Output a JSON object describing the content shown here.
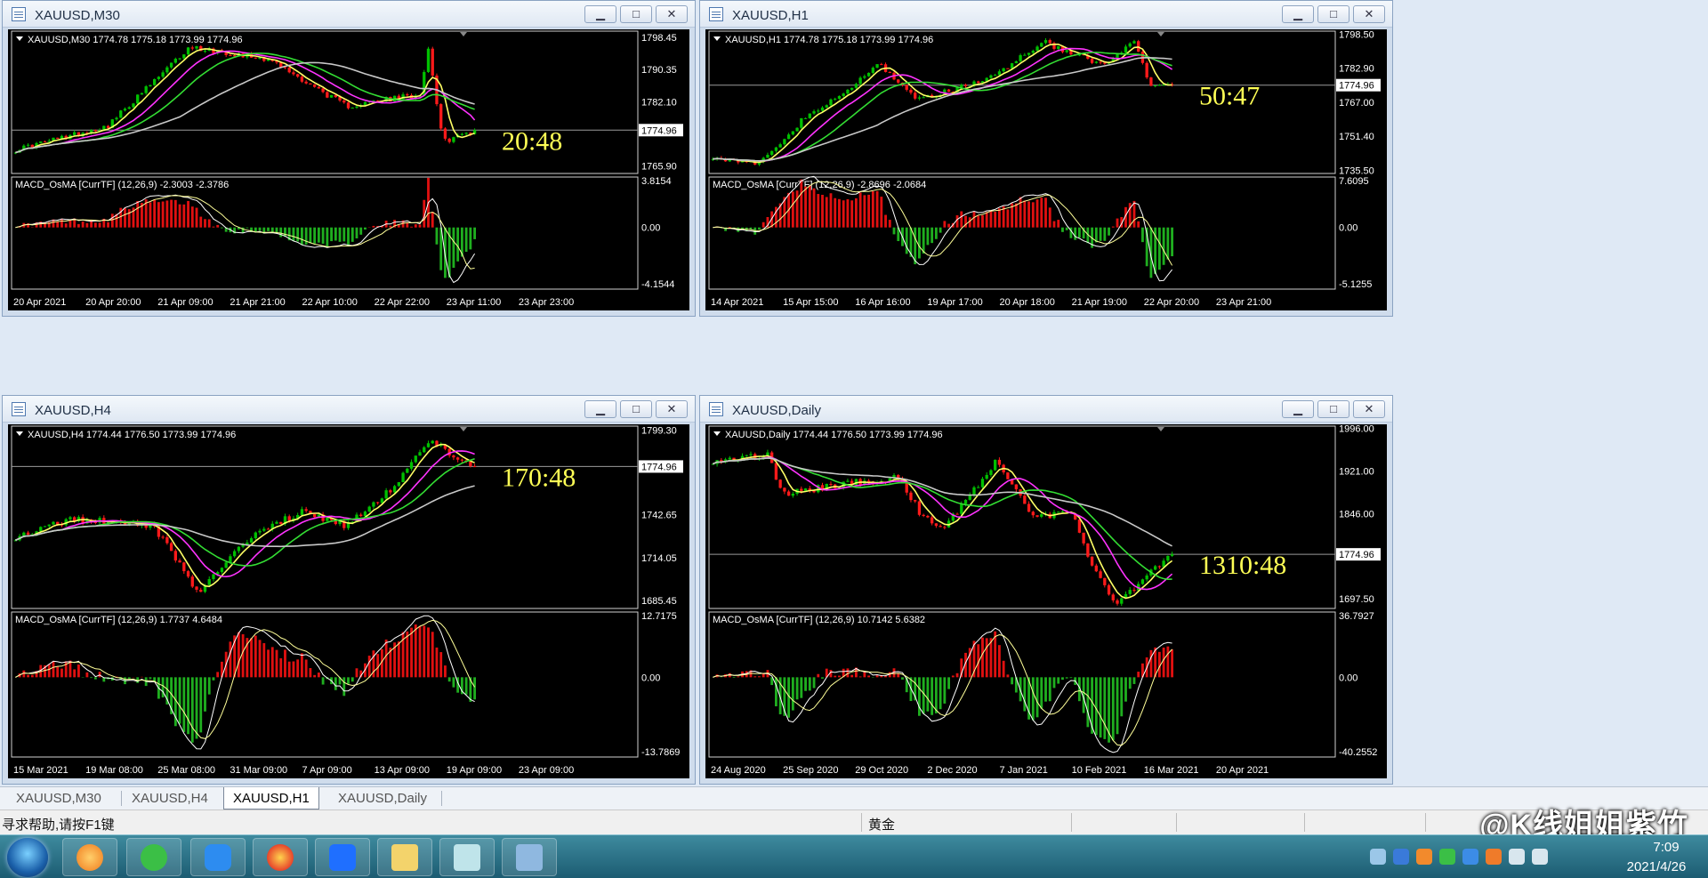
{
  "colors": {
    "background": "#000000",
    "bull_candle": "#00c000",
    "bear_candle": "#ff1a1a",
    "ma_fast": "#ffff66",
    "ma_mid": "#ff33ff",
    "ma_slow": "#33dd33",
    "ma_long": "#c8c8c8",
    "hist_up": "#e01010",
    "hist_down": "#1fae1f",
    "countdown": "#ffff55",
    "axis_text": "#ffffff"
  },
  "windows": [
    {
      "title": "XAUUSD,M30",
      "ohlc_label": "XAUUSD,M30  1774.78 1775.18 1773.99 1774.96",
      "price_ticks": [
        "1798.45",
        "1790.35",
        "1782.10",
        "1774.96",
        "1765.90"
      ],
      "price_tick_values": [
        1798.45,
        1790.35,
        1782.1,
        1774.96,
        1765.9
      ],
      "current_price": "1774.96",
      "countdown": "20:48",
      "macd_label": "MACD_OsMA [CurrTF] (12,26,9) -2.3003 -2.3786",
      "macd_ticks": [
        "3.8154",
        "0.00",
        "-4.1544"
      ],
      "date_labels": [
        "20 Apr 2021",
        "20 Apr 20:00",
        "21 Apr 09:00",
        "21 Apr 21:00",
        "22 Apr 10:00",
        "22 Apr 22:00",
        "23 Apr 11:00",
        "23 Apr 23:00"
      ],
      "series": {
        "start": 1770,
        "end": 1774.96,
        "min": 1764,
        "max": 1800,
        "pivots": [
          [
            0,
            1770
          ],
          [
            0.2,
            1776
          ],
          [
            0.38,
            1796
          ],
          [
            0.55,
            1793
          ],
          [
            0.72,
            1781
          ],
          [
            0.88,
            1784
          ],
          [
            0.9,
            1796
          ],
          [
            0.93,
            1772
          ],
          [
            1.0,
            1774.96
          ]
        ]
      }
    },
    {
      "title": "XAUUSD,H1",
      "ohlc_label": "XAUUSD,H1  1774.78 1775.18 1773.99 1774.96",
      "price_ticks": [
        "1798.50",
        "1782.90",
        "1774.96",
        "1767.00",
        "1751.40",
        "1735.50"
      ],
      "price_tick_values": [
        1798.5,
        1782.9,
        1774.96,
        1767.0,
        1751.4,
        1735.5
      ],
      "current_price": "1774.96",
      "countdown": "50:47",
      "macd_label": "MACD_OsMA [CurrTF] (12,26,9) -2.8696 -2.0684",
      "macd_ticks": [
        "7.6095",
        "0.00",
        "-5.1255"
      ],
      "date_labels": [
        "14 Apr 2021",
        "15 Apr 15:00",
        "16 Apr 16:00",
        "19 Apr 17:00",
        "20 Apr 18:00",
        "21 Apr 19:00",
        "22 Apr 20:00",
        "23 Apr 21:00"
      ],
      "series": {
        "start": 1742,
        "end": 1774.96,
        "min": 1734,
        "max": 1800,
        "pivots": [
          [
            0,
            1742
          ],
          [
            0.1,
            1738
          ],
          [
            0.2,
            1760
          ],
          [
            0.28,
            1770
          ],
          [
            0.36,
            1785
          ],
          [
            0.45,
            1768
          ],
          [
            0.6,
            1778
          ],
          [
            0.72,
            1795
          ],
          [
            0.85,
            1784
          ],
          [
            0.92,
            1795
          ],
          [
            0.95,
            1775
          ],
          [
            1.0,
            1774.96
          ]
        ]
      }
    },
    {
      "title": "XAUUSD,H4",
      "ohlc_label": "XAUUSD,H4  1774.44 1776.50 1773.99 1774.96",
      "price_ticks": [
        "1799.30",
        "1774.96",
        "1742.65",
        "1714.05",
        "1685.45"
      ],
      "price_tick_values": [
        1799.3,
        1774.96,
        1742.65,
        1714.05,
        1685.45
      ],
      "current_price": "1774.96",
      "countdown": "170:48",
      "macd_label": "MACD_OsMA [CurrTF] (12,26,9) 1.7737 4.6484",
      "macd_ticks": [
        "12.7175",
        "0.00",
        "-13.7869"
      ],
      "date_labels": [
        "15 Mar 2021",
        "19 Mar 08:00",
        "25 Mar 08:00",
        "31 Mar 09:00",
        "7 Apr 09:00",
        "13 Apr 09:00",
        "19 Apr 09:00",
        "23 Apr 09:00"
      ],
      "series": {
        "start": 1728,
        "end": 1774.96,
        "min": 1680,
        "max": 1802,
        "pivots": [
          [
            0,
            1728
          ],
          [
            0.12,
            1740
          ],
          [
            0.3,
            1735
          ],
          [
            0.4,
            1690
          ],
          [
            0.5,
            1725
          ],
          [
            0.62,
            1745
          ],
          [
            0.72,
            1735
          ],
          [
            0.82,
            1760
          ],
          [
            0.9,
            1792
          ],
          [
            1.0,
            1774.96
          ]
        ]
      }
    },
    {
      "title": "XAUUSD,Daily",
      "ohlc_label": "XAUUSD,Daily  1774.44 1776.50 1773.99 1774.96",
      "price_ticks": [
        "1996.00",
        "1921.00",
        "1846.00",
        "1774.96",
        "1697.50"
      ],
      "price_tick_values": [
        1996.0,
        1921.0,
        1846.0,
        1774.96,
        1697.5
      ],
      "current_price": "1774.96",
      "countdown": "1310:48",
      "macd_label": "MACD_OsMA [CurrTF] (12,26,9) 10.7142 5.6382",
      "macd_ticks": [
        "36.7927",
        "0.00",
        "-40.2552"
      ],
      "date_labels": [
        "24 Aug 2020",
        "25 Sep 2020",
        "29 Oct 2020",
        "2 Dec 2020",
        "7 Jan 2021",
        "10 Feb 2021",
        "16 Mar 2021",
        "20 Apr 2021"
      ],
      "series": {
        "start": 1940,
        "end": 1774.96,
        "min": 1680,
        "max": 2000,
        "pivots": [
          [
            0,
            1940
          ],
          [
            0.12,
            1950
          ],
          [
            0.15,
            1880
          ],
          [
            0.3,
            1900
          ],
          [
            0.4,
            1910
          ],
          [
            0.45,
            1850
          ],
          [
            0.5,
            1820
          ],
          [
            0.62,
            1940
          ],
          [
            0.7,
            1840
          ],
          [
            0.78,
            1850
          ],
          [
            0.82,
            1760
          ],
          [
            0.88,
            1690
          ],
          [
            0.95,
            1740
          ],
          [
            1.0,
            1774.96
          ]
        ]
      }
    }
  ],
  "tabs": [
    {
      "label": "XAUUSD,M30",
      "active": false
    },
    {
      "label": "XAUUSD,H4",
      "active": false
    },
    {
      "label": "XAUUSD,H1",
      "active": true
    },
    {
      "label": "XAUUSD,Daily",
      "active": false
    }
  ],
  "status": {
    "help_text": "寻求帮助,请按F1键",
    "symbol_text": "黄金",
    "watermark": "@K线姐姐紫竹"
  },
  "taskbar": {
    "apps": [
      "firefox-like-app-icon",
      "wechat-icon",
      "feishu-icon",
      "firefox-icon",
      "lark-icon",
      "folder-icon",
      "trading-app-icon",
      "image-viewer-icon"
    ],
    "clock_time": "7:09",
    "clock_date": "2021/4/26"
  }
}
